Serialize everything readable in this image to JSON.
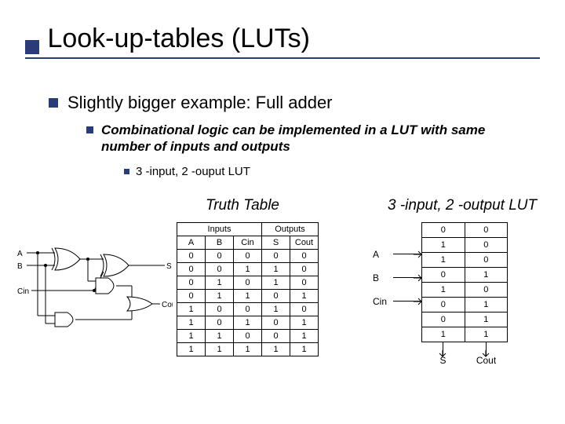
{
  "title": "Look-up-tables (LUTs)",
  "bullet1": "Slightly bigger example: Full adder",
  "bullet2": "Combinational logic can be implemented in a LUT with same number of inputs and outputs",
  "bullet3": "3 -input, 2 -ouput LUT",
  "truth_caption": "Truth Table",
  "lut_caption": "3 -input, 2 -output LUT",
  "truth": {
    "group_inputs": "Inputs",
    "group_outputs": "Outputs",
    "headers": [
      "A",
      "B",
      "Cin",
      "S",
      "Cout"
    ],
    "rows": [
      [
        "0",
        "0",
        "0",
        "0",
        "0"
      ],
      [
        "0",
        "0",
        "1",
        "1",
        "0"
      ],
      [
        "0",
        "1",
        "0",
        "1",
        "0"
      ],
      [
        "0",
        "1",
        "1",
        "0",
        "1"
      ],
      [
        "1",
        "0",
        "0",
        "1",
        "0"
      ],
      [
        "1",
        "0",
        "1",
        "0",
        "1"
      ],
      [
        "1",
        "1",
        "0",
        "0",
        "1"
      ],
      [
        "1",
        "1",
        "1",
        "1",
        "1"
      ]
    ]
  },
  "lut": {
    "inputs": [
      "A",
      "B",
      "Cin"
    ],
    "rows": [
      [
        "0",
        "0"
      ],
      [
        "1",
        "0"
      ],
      [
        "1",
        "0"
      ],
      [
        "0",
        "1"
      ],
      [
        "1",
        "0"
      ],
      [
        "0",
        "1"
      ],
      [
        "0",
        "1"
      ],
      [
        "1",
        "1"
      ]
    ],
    "outputs": [
      "S",
      "Cout"
    ]
  },
  "circuit_labels": {
    "A": "A",
    "B": "B",
    "Cin": "Cin",
    "S": "S",
    "Cout": "Cout"
  }
}
